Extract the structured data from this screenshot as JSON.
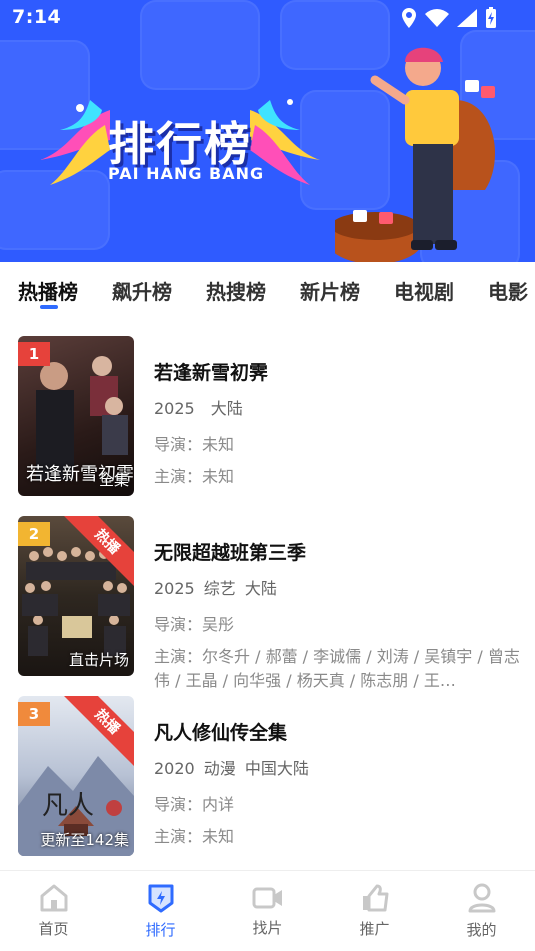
{
  "status_bar": {
    "time": "7:14"
  },
  "banner": {
    "title_cn": "排行榜",
    "title_en": "PAI HANG BANG"
  },
  "tabs": [
    {
      "label": "热播榜",
      "active": true
    },
    {
      "label": "飙升榜"
    },
    {
      "label": "热搜榜"
    },
    {
      "label": "新片榜"
    },
    {
      "label": "电视剧"
    },
    {
      "label": "电影"
    }
  ],
  "list": [
    {
      "rank": "1",
      "rank_color": "#e6423b",
      "name": "若逢新雪初霁",
      "meta": "2025　大陆",
      "director_label": "导演：",
      "director": "未知",
      "cast_label": "主演：",
      "cast": "未知",
      "poster_caption": "全集",
      "poster_text": "若逢新雪初霁",
      "ribbon": "",
      "poster_color_top": "#3b2a2a",
      "poster_color_bottom": "#1c1414"
    },
    {
      "rank": "2",
      "rank_color": "#f2b531",
      "name": "无限超越班第三季",
      "meta": "2025 综艺 大陆",
      "director_label": "导演：",
      "director": "吴彤",
      "cast_label": "主演：",
      "cast": "尔冬升 / 郝蕾 / 李诚儒 / 刘涛 / 吴镇宇 / 曾志伟 / 王晶 / 向华强 / 杨天真 / 陈志朋 / 王…",
      "poster_caption": "直击片场",
      "poster_text": "",
      "ribbon": "热播",
      "poster_color_top": "#3a3530",
      "poster_color_bottom": "#1e1b18"
    },
    {
      "rank": "3",
      "rank_color": "#f08a3c",
      "name": "凡人修仙传全集",
      "meta": "2020 动漫 中国大陆",
      "director_label": "导演：",
      "director": "内详",
      "cast_label": "主演：",
      "cast": "未知",
      "poster_caption": "更新至142集",
      "poster_text": "凡人",
      "ribbon": "热播",
      "poster_color_top": "#cfd8e6",
      "poster_color_bottom": "#6d7a96"
    }
  ],
  "nav": [
    {
      "label": "首页",
      "icon": "home-icon"
    },
    {
      "label": "排行",
      "icon": "ranking-icon",
      "active": true
    },
    {
      "label": "找片",
      "icon": "video-camera-icon"
    },
    {
      "label": "推广",
      "icon": "promote-icon"
    },
    {
      "label": "我的",
      "icon": "user-icon"
    }
  ],
  "colors": {
    "accent": "#2f6bff",
    "banner": "#2f5bff"
  }
}
